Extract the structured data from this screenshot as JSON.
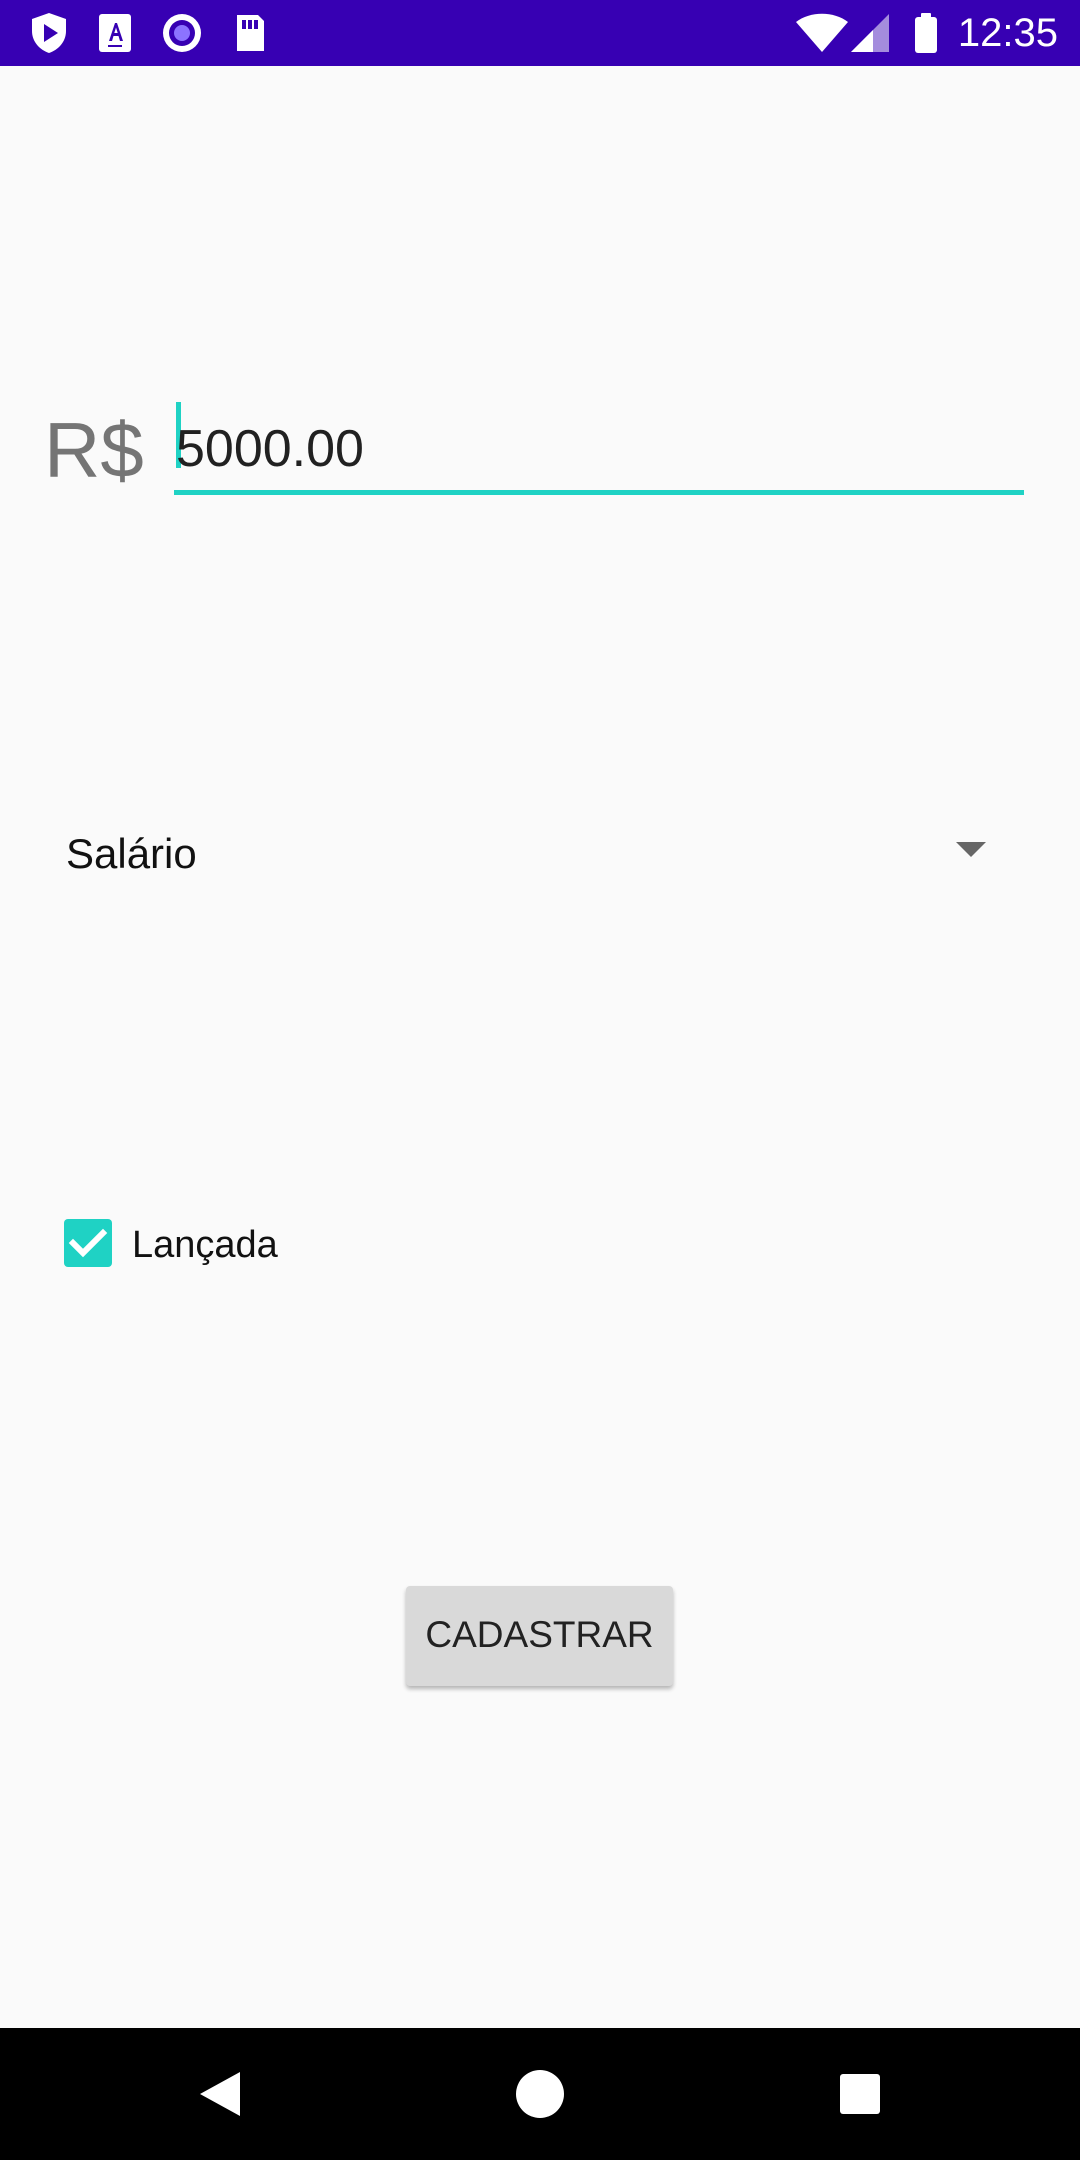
{
  "status_bar": {
    "time": "12:35",
    "left_icons": [
      "shield-play-icon",
      "text-a-icon",
      "record-icon",
      "sd-card-icon"
    ],
    "right_icons": [
      "wifi-icon",
      "signal-icon",
      "battery-icon"
    ]
  },
  "form": {
    "currency_label": "R$",
    "amount_value": "5000.00",
    "category_selected": "Salário",
    "checkbox_label": "Lançada",
    "checkbox_checked": true,
    "submit_label": "CADASTRAR"
  },
  "navigation": {
    "buttons": [
      "back-icon",
      "home-icon",
      "recents-icon"
    ]
  },
  "colors": {
    "status_bar": "#3700b3",
    "accent": "#1fd2c4",
    "background": "#fafafa",
    "button": "#d9d9d9",
    "nav_bar": "#000000"
  }
}
